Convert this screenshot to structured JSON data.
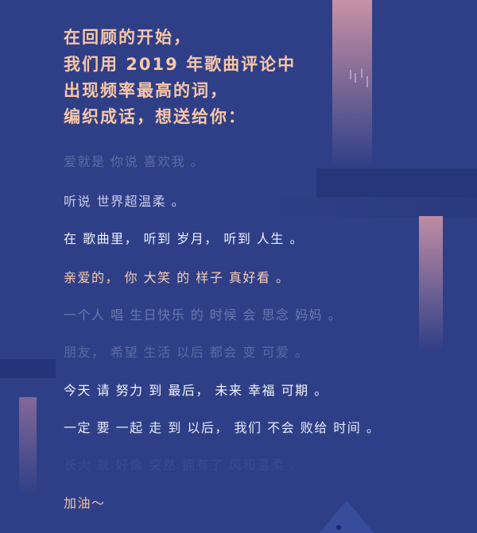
{
  "heading": {
    "lines": [
      "在回顾的开始，",
      "我们用 2019 年歌曲评论中",
      "出现频率最高的词，",
      "编织成话，想送给你："
    ],
    "color": "#f7c7a8"
  },
  "poem": {
    "lines": [
      {
        "text": "爱就是 你说 喜欢我 。",
        "color": "#5d6aa3"
      },
      {
        "text": "听说 世界超温柔 。",
        "color": "#c9cdea"
      },
      {
        "text": "在 歌曲里， 听到 岁月， 听到 人生 。",
        "color": "#eef0fb"
      },
      {
        "text": "亲爱的， 你 大笑 的 样子 真好看 。",
        "color": "#f7cdb2"
      },
      {
        "text": "一个人 唱 生日快乐 的 时候 会 思念 妈妈 。",
        "color": "#6b77ad"
      },
      {
        "text": "朋友， 希望 生活 以后 都会 变 可爱 。",
        "color": "#5d6aa3"
      },
      {
        "text": "今天 请 努力 到 最后， 未来 幸福 可期 。",
        "color": "#f3f4fb"
      },
      {
        "text": "一定 要 一起 走 到 以后， 我们 不会 败给 时间 。",
        "color": "#e6e8f7"
      },
      {
        "text": "长大 就 好像 突然 拥有了 风和温柔 。",
        "color": "#3d4a8f"
      },
      {
        "text": "加油～",
        "color": "#f1c2a5"
      }
    ]
  },
  "colors": {
    "background": "#2f3f87",
    "stripe_pink": "#d99aa8"
  }
}
